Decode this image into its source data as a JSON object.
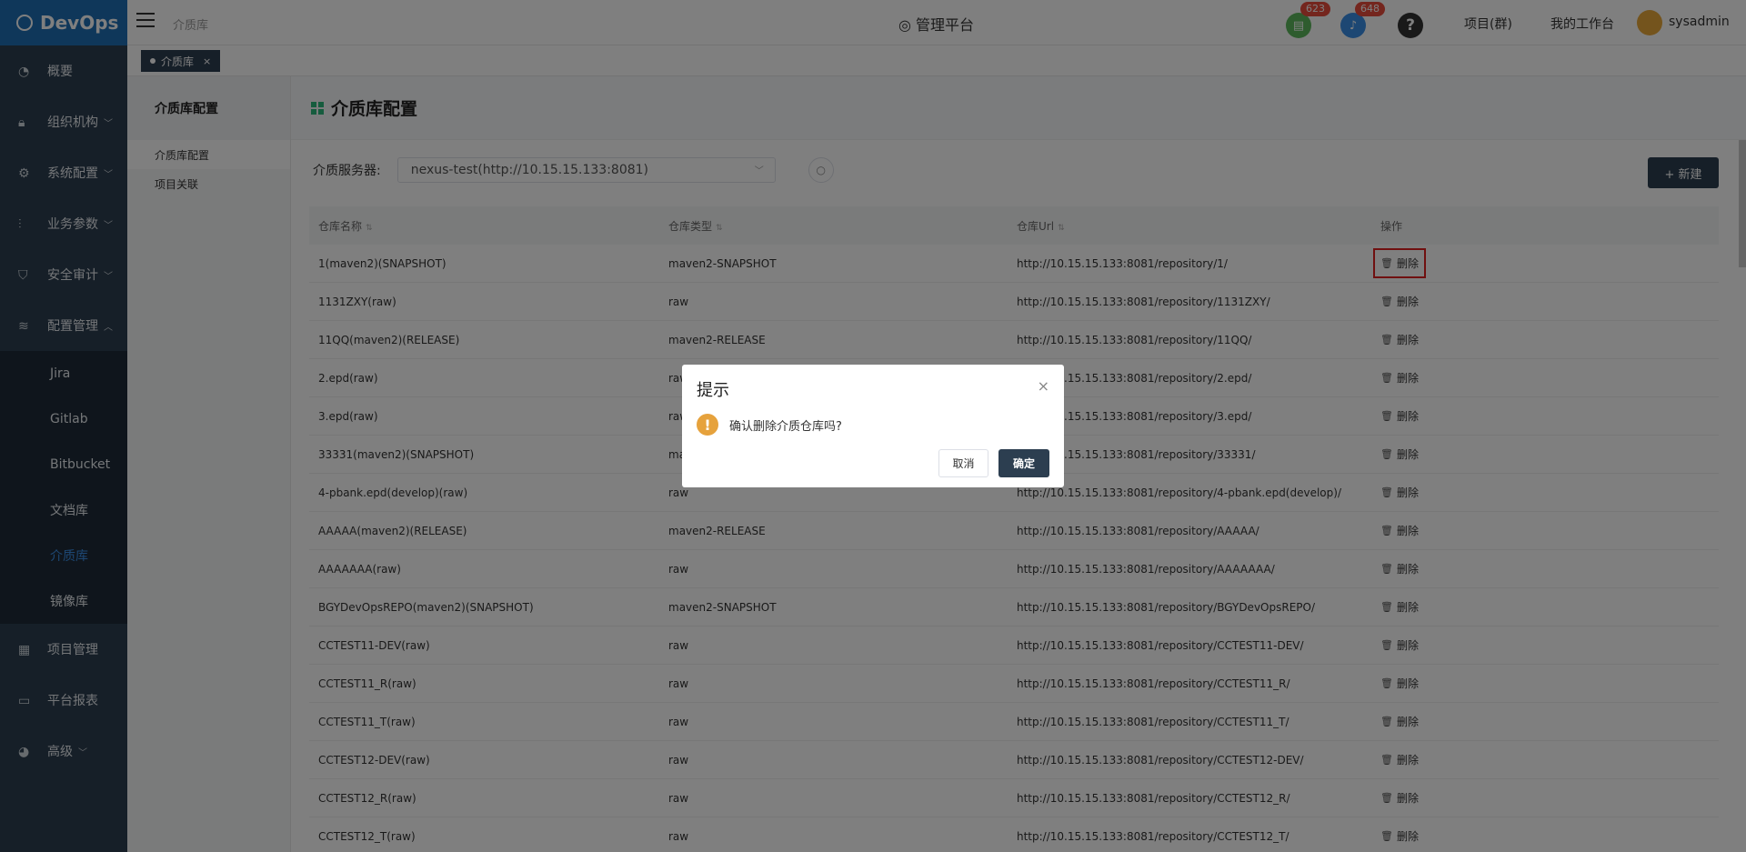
{
  "app": {
    "logo": "DevOps"
  },
  "sidebar": {
    "items": [
      {
        "label": "概要",
        "icon": "dashboard-icon"
      },
      {
        "label": "组织机构",
        "icon": "lock-icon"
      },
      {
        "label": "系统配置",
        "icon": "gear-icon"
      },
      {
        "label": "业务参数",
        "icon": "sliders-icon"
      },
      {
        "label": "安全审计",
        "icon": "shield-icon"
      },
      {
        "label": "配置管理",
        "icon": "database-icon"
      }
    ],
    "sub": [
      "Jira",
      "Gitlab",
      "Bitbucket",
      "文档库",
      "介质库",
      "镜像库"
    ],
    "items2": [
      {
        "label": "项目管理",
        "icon": "grid-icon"
      },
      {
        "label": "平台报表",
        "icon": "monitor-icon"
      },
      {
        "label": "高级",
        "icon": "palette-icon"
      }
    ]
  },
  "topbar": {
    "breadcrumb": "介质库",
    "platform": "管理平台",
    "badge1": "623",
    "badge2": "648",
    "project": "项目(群)",
    "workbench": "我的工作台",
    "user": "sysadmin"
  },
  "tabbar": {
    "tab": "介质库",
    "close": "×"
  },
  "left_panel": {
    "title": "介质库配置",
    "items": [
      "介质库配置",
      "项目关联"
    ]
  },
  "page": {
    "title": "介质库配置",
    "filter_label": "介质服务器:",
    "server": "nexus-test(http://10.15.15.133:8081)",
    "new_button": "+ 新建"
  },
  "table": {
    "headers": [
      "仓库名称",
      "仓库类型",
      "仓库Url",
      "操作"
    ],
    "action": "删除",
    "rows": [
      [
        "1(maven2)(SNAPSHOT)",
        "maven2-SNAPSHOT",
        "http://10.15.15.133:8081/repository/1/"
      ],
      [
        "1131ZXY(raw)",
        "raw",
        "http://10.15.15.133:8081/repository/1131ZXY/"
      ],
      [
        "11QQ(maven2)(RELEASE)",
        "maven2-RELEASE",
        "http://10.15.15.133:8081/repository/11QQ/"
      ],
      [
        "2.epd(raw)",
        "raw",
        "http://10.15.15.133:8081/repository/2.epd/"
      ],
      [
        "3.epd(raw)",
        "raw",
        "http://10.15.15.133:8081/repository/3.epd/"
      ],
      [
        "33331(maven2)(SNAPSHOT)",
        "maven2-SNAPSHOT",
        "http://10.15.15.133:8081/repository/33331/"
      ],
      [
        "4-pbank.epd(develop)(raw)",
        "raw",
        "http://10.15.15.133:8081/repository/4-pbank.epd(develop)/"
      ],
      [
        "AAAAA(maven2)(RELEASE)",
        "maven2-RELEASE",
        "http://10.15.15.133:8081/repository/AAAAA/"
      ],
      [
        "AAAAAAA(raw)",
        "raw",
        "http://10.15.15.133:8081/repository/AAAAAAA/"
      ],
      [
        "BGYDevOpsREPO(maven2)(SNAPSHOT)",
        "maven2-SNAPSHOT",
        "http://10.15.15.133:8081/repository/BGYDevOpsREPO/"
      ],
      [
        "CCTEST11-DEV(raw)",
        "raw",
        "http://10.15.15.133:8081/repository/CCTEST11-DEV/"
      ],
      [
        "CCTEST11_R(raw)",
        "raw",
        "http://10.15.15.133:8081/repository/CCTEST11_R/"
      ],
      [
        "CCTEST11_T(raw)",
        "raw",
        "http://10.15.15.133:8081/repository/CCTEST11_T/"
      ],
      [
        "CCTEST12-DEV(raw)",
        "raw",
        "http://10.15.15.133:8081/repository/CCTEST12-DEV/"
      ],
      [
        "CCTEST12_R(raw)",
        "raw",
        "http://10.15.15.133:8081/repository/CCTEST12_R/"
      ],
      [
        "CCTEST12_T(raw)",
        "raw",
        "http://10.15.15.133:8081/repository/CCTEST12_T/"
      ]
    ]
  },
  "dialog": {
    "title": "提示",
    "message": "确认删除介质仓库吗?",
    "cancel": "取消",
    "ok": "确定",
    "close": "×"
  }
}
